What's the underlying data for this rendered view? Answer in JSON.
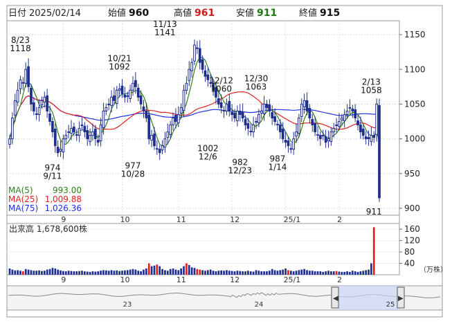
{
  "header": {
    "date_label": "日付",
    "date_value": "2025/02/14",
    "open_label": "始値",
    "open_value": "960",
    "high_label": "高値",
    "high_value": "961",
    "low_label": "安値",
    "low_value": "911",
    "close_label": "終値",
    "close_value": "915"
  },
  "ma_legend": [
    {
      "label": "MA(5)",
      "value": "993.00",
      "color": "#2e7d1e"
    },
    {
      "label": "MA(25)",
      "value": "1,009.88",
      "color": "#e02020"
    },
    {
      "label": "MA(75)",
      "value": "1,026.36",
      "color": "#2030e0"
    }
  ],
  "volume_label": "出来高  1,678,600株",
  "volume_unit": "（万株）",
  "colors": {
    "up": "#ffffff",
    "down": "#1f2f8f",
    "border": "#1f2f8f",
    "spike": "#e02020",
    "ma5": "#2e7d1e",
    "ma25": "#e02020",
    "ma75": "#2030e0"
  },
  "chart_data": {
    "type": "candlestick",
    "price_axis": {
      "ticks": [
        "1150",
        "1100",
        "1050",
        "1000",
        "950",
        "900"
      ],
      "ylim": [
        890,
        1170
      ]
    },
    "volume_axis": {
      "ticks": [
        "160",
        "120",
        "80",
        "40"
      ],
      "ylim": [
        0,
        180
      ]
    },
    "x_ticks": [
      "9",
      "10",
      "11",
      "12",
      "25/1",
      "2"
    ],
    "navigator_ticks": [
      "23",
      "24",
      "25"
    ],
    "annotations": [
      {
        "date": "8/23",
        "price": "1118",
        "kind": "high"
      },
      {
        "date": "9/11",
        "price": "974",
        "kind": "low"
      },
      {
        "date": "10/21",
        "price": "1092",
        "kind": "high"
      },
      {
        "date": "10/28",
        "price": "977",
        "kind": "low"
      },
      {
        "date": "11/13",
        "price": "1141",
        "kind": "high"
      },
      {
        "date": "12/6",
        "price": "1002",
        "kind": "low"
      },
      {
        "date": "12/12",
        "price": "1060",
        "kind": "high"
      },
      {
        "date": "12/23",
        "price": "982",
        "kind": "low"
      },
      {
        "date": "12/30",
        "price": "1063",
        "kind": "high"
      },
      {
        "date": "1/14",
        "price": "987",
        "kind": "low"
      },
      {
        "date": "2/13",
        "price": "1058",
        "kind": "high"
      },
      {
        "date": "2/14",
        "price": "911",
        "kind": "low"
      }
    ],
    "closes": [
      1000,
      1030,
      1055,
      1070,
      1085,
      1080,
      1100,
      1075,
      1050,
      1040,
      1035,
      1045,
      1055,
      1060,
      1040,
      1025,
      1010,
      990,
      980,
      985,
      1000,
      1005,
      1010,
      1015,
      1010,
      1005,
      1015,
      1020,
      1010,
      1000,
      1005,
      1010,
      1000,
      995,
      1020,
      1040,
      1045,
      1050,
      1060,
      1055,
      1070,
      1072,
      1065,
      1060,
      1062,
      1070,
      1080,
      1075,
      1060,
      1050,
      1040,
      1030,
      1000,
      1005,
      990,
      985,
      980,
      990,
      1000,
      1010,
      1020,
      1030,
      1025,
      1035,
      1045,
      1070,
      1080,
      1100,
      1110,
      1135,
      1130,
      1110,
      1100,
      1090,
      1085,
      1080,
      1070,
      1060,
      1050,
      1045,
      1040,
      1050,
      1040,
      1035,
      1030,
      1040,
      1035,
      1030,
      1020,
      1015,
      1010,
      1020,
      1025,
      1035,
      1040,
      1050,
      1045,
      1040,
      1030,
      1025,
      1020,
      1010,
      1000,
      995,
      990,
      985,
      1000,
      1010,
      1030,
      1050,
      1055,
      1040,
      1030,
      1020,
      1010,
      1005,
      1000,
      1005,
      995,
      1000,
      1010,
      1015,
      1020,
      1025,
      1030,
      1035,
      1040,
      1045,
      1040,
      1030,
      1020,
      1010,
      1005,
      1000,
      1000,
      1005,
      1002,
      1050,
      915
    ],
    "volumes": [
      22,
      18,
      15,
      16,
      14,
      12,
      20,
      18,
      16,
      14,
      14,
      15,
      13,
      14,
      18,
      20,
      24,
      22,
      18,
      15,
      13,
      12,
      14,
      13,
      12,
      12,
      13,
      14,
      12,
      11,
      10,
      12,
      11,
      12,
      14,
      16,
      15,
      14,
      16,
      14,
      15,
      13,
      14,
      15,
      16,
      18,
      20,
      18,
      14,
      12,
      18,
      22,
      40,
      30,
      32,
      36,
      30,
      20,
      16,
      14,
      20,
      22,
      18,
      16,
      22,
      30,
      40,
      34,
      26,
      24,
      20,
      18,
      16,
      14,
      16,
      18,
      14,
      12,
      14,
      15,
      14,
      16,
      14,
      13,
      12,
      14,
      13,
      12,
      12,
      14,
      12,
      11,
      16,
      14,
      12,
      12,
      12,
      14,
      20,
      16,
      14,
      16,
      18,
      22,
      16,
      14,
      12,
      14,
      16,
      18,
      20,
      16,
      14,
      14,
      12,
      12,
      12,
      10,
      12,
      14,
      12,
      12,
      13,
      11,
      10,
      10,
      12,
      10,
      14,
      12,
      10,
      12,
      14,
      16,
      18,
      40,
      167
    ],
    "spike_indices": [
      5,
      52,
      55,
      66,
      70,
      71,
      104,
      122,
      136
    ]
  }
}
